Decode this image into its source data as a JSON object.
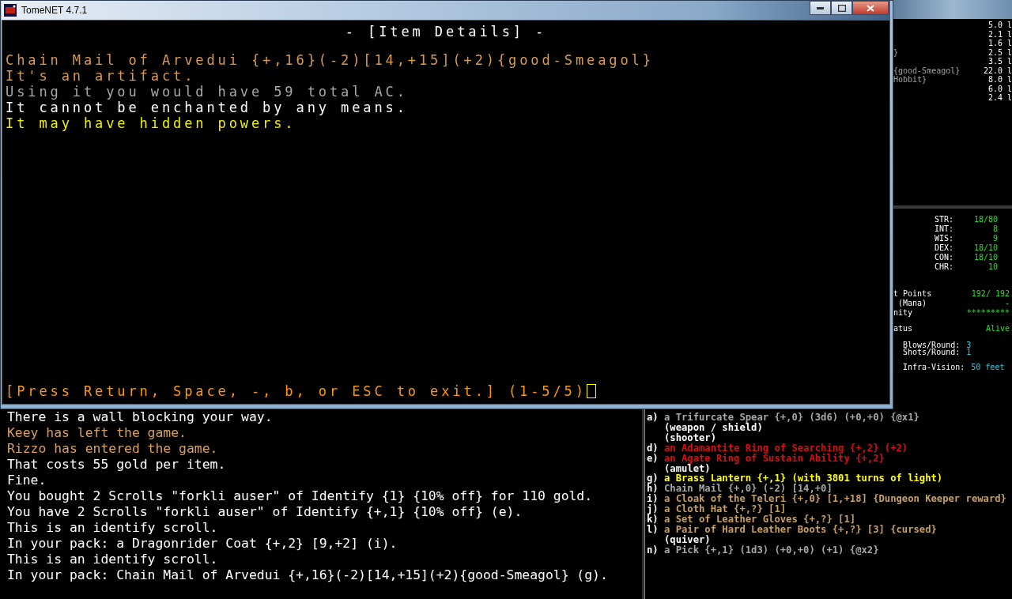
{
  "window": {
    "title": "TomeNET 4.7.1"
  },
  "details": {
    "header": "- [Item Details] -",
    "lines": [
      {
        "text": "Chain Mail of Arvedui {+,16}(-2)[14,+15](+2){good-Smeagol}",
        "color": "#d89a50"
      },
      {
        "text": "It's an artifact.",
        "color": "#d89a50"
      },
      {
        "text": "Using it you would have 59 total AC.",
        "color": "#a8a8a8"
      },
      {
        "text": "It cannot be enchanted by any means.",
        "color": "#ffffff"
      },
      {
        "text": "It may have hidden powers.",
        "color": "#f0f000"
      }
    ],
    "prompt": "[Press Return, Space, -, b, or ESC to exit.]",
    "page": "(1-5/5)"
  },
  "side_inventory": [
    {
      "right": "5.0 l"
    },
    {
      "right": "2.1 l"
    },
    {
      "right": "1.6 l"
    },
    {
      "left": "}",
      "right": "2.5 l"
    },
    {
      "right": "3.5 l"
    },
    {
      "left": "{good-Smeagol}",
      "right": "22.0 l"
    },
    {
      "left": "Hobbit}",
      "right": "8.0 l"
    },
    {
      "right": "6.0 l"
    },
    {
      "right": "2.4 l"
    }
  ],
  "stats": [
    {
      "label": "STR:",
      "value": "18/80"
    },
    {
      "label": "INT:",
      "value": "8"
    },
    {
      "label": "WIS:",
      "value": "9"
    },
    {
      "label": "DEX:",
      "value": "18/10"
    },
    {
      "label": "CON:",
      "value": "18/10"
    },
    {
      "label": "CHR:",
      "value": "10"
    }
  ],
  "status": [
    {
      "label": "t Points",
      "value": "192/ 192"
    },
    {
      "label": " (Mana)",
      "value": "-"
    },
    {
      "label": "nity",
      "value": "*********"
    },
    {
      "label": "atus",
      "value": "Alive"
    }
  ],
  "combat": [
    {
      "label": "Blows/Round:",
      "value": "3"
    },
    {
      "label": "Shots/Round:",
      "value": "1"
    },
    {
      "label": "Infra-Vision:",
      "value": "50 feet"
    }
  ],
  "messages": [
    {
      "text": "There is a wall blocking your way.",
      "color": "#ffffff"
    },
    {
      "text": "Keey has left the game.",
      "color": "#d8a060"
    },
    {
      "text": "Rizzo has entered the game.",
      "color": "#d8a060"
    },
    {
      "text": "That costs 55 gold per item.",
      "color": "#ffffff"
    },
    {
      "text": "Fine.",
      "color": "#ffffff"
    },
    {
      "text": "You bought 2 Scrolls \"forkli auser\" of Identify {1} {10% off} for 110 gold.",
      "color": "#ffffff"
    },
    {
      "text": "You have 2 Scrolls \"forkli auser\" of Identify {+,1} {10% off} (e).",
      "color": "#ffffff"
    },
    {
      "text": "This is an identify scroll.",
      "color": "#ffffff"
    },
    {
      "text": "In your pack: a Dragonrider Coat {+,2} [9,+2] (i).",
      "color": "#ffffff"
    },
    {
      "text": "This is an identify scroll.",
      "color": "#ffffff"
    },
    {
      "text": "In your pack: Chain Mail of Arvedui {+,16}(-2)[14,+15](+2){good-Smeagol} (g).",
      "color": "#ffffff"
    }
  ],
  "equipment": [
    {
      "slot": "a)",
      "text": "a Trifurcate Spear {+,0} (3d6) (+0,+0) {@x1}",
      "color": "#a8a8a8"
    },
    {
      "text": "(weapon / shield)",
      "color": "#ffffff"
    },
    {
      "text": "(shooter)",
      "color": "#ffffff"
    },
    {
      "slot": "d)",
      "text": "an Adamantite Ring of Searching {+,2} (+2)",
      "color": "#d81010"
    },
    {
      "slot": "e)",
      "text": "an Agate Ring of Sustain Ability {+,2}",
      "color": "#d81010"
    },
    {
      "text": "(amulet)",
      "color": "#ffffff"
    },
    {
      "slot": "g)",
      "text": "a Brass Lantern {+,1} (with 3801 turns of light)",
      "color": "#ffff00"
    },
    {
      "slot": "h)",
      "text": "Chain Mail {+,0} (-2) [14,+0]",
      "color": "#a8a8a8"
    },
    {
      "slot": "i)",
      "text": "a Cloak of the Teleri {+,0} [1,+18] {Dungeon Keeper reward}",
      "color": "#c8a060"
    },
    {
      "slot": "j)",
      "text": "a Cloth Hat {+,?} [1]",
      "color": "#c8a060"
    },
    {
      "slot": "k)",
      "text": "a Set of Leather Gloves {+,?} [1]",
      "color": "#c8a060"
    },
    {
      "slot": "l)",
      "text": "a Pair of Hard Leather Boots {+,?} [3] {cursed}",
      "color": "#c8a060"
    },
    {
      "text": "(quiver)",
      "color": "#ffffff"
    },
    {
      "slot": "n)",
      "text": "a Pick {+,1} (1d3) (+0,+0) (+1) {@x2}",
      "color": "#a8a8a8"
    }
  ]
}
